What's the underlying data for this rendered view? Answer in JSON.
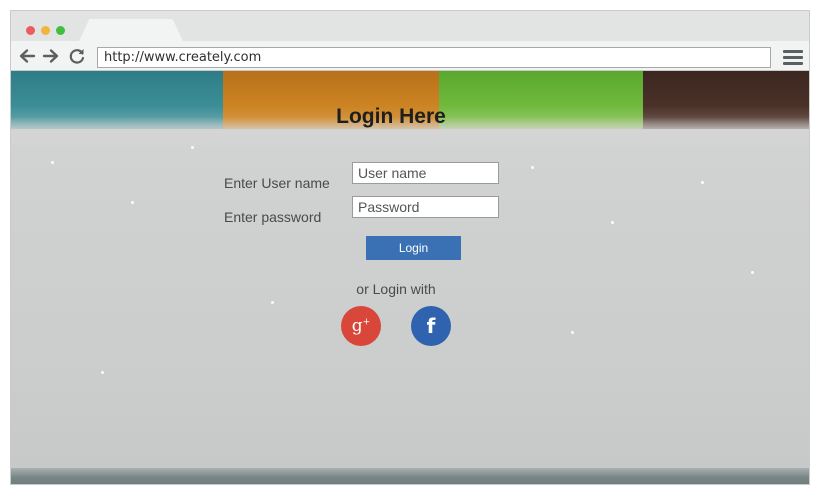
{
  "browser": {
    "url": "http://www.creately.com"
  },
  "login": {
    "title": "Login Here",
    "username_label": "Enter User name",
    "username_placeholder": "User name",
    "password_label": "Enter password",
    "password_placeholder": "Password",
    "login_button": "Login",
    "alt_login_text": "or Login with",
    "google_glyph": "g",
    "google_sup": "+",
    "facebook_glyph": "f"
  },
  "colors": {
    "stripe_teal": "#2e7d86",
    "stripe_orange": "#cc8423",
    "stripe_green": "#70b93d",
    "stripe_brown": "#4a3128",
    "login_button": "#3a71b5",
    "google": "#d8473a",
    "facebook": "#2f63b0"
  },
  "icons": [
    "back-arrow-icon",
    "forward-arrow-icon",
    "reload-icon",
    "hamburger-menu-icon",
    "google-plus-icon",
    "facebook-icon"
  ]
}
